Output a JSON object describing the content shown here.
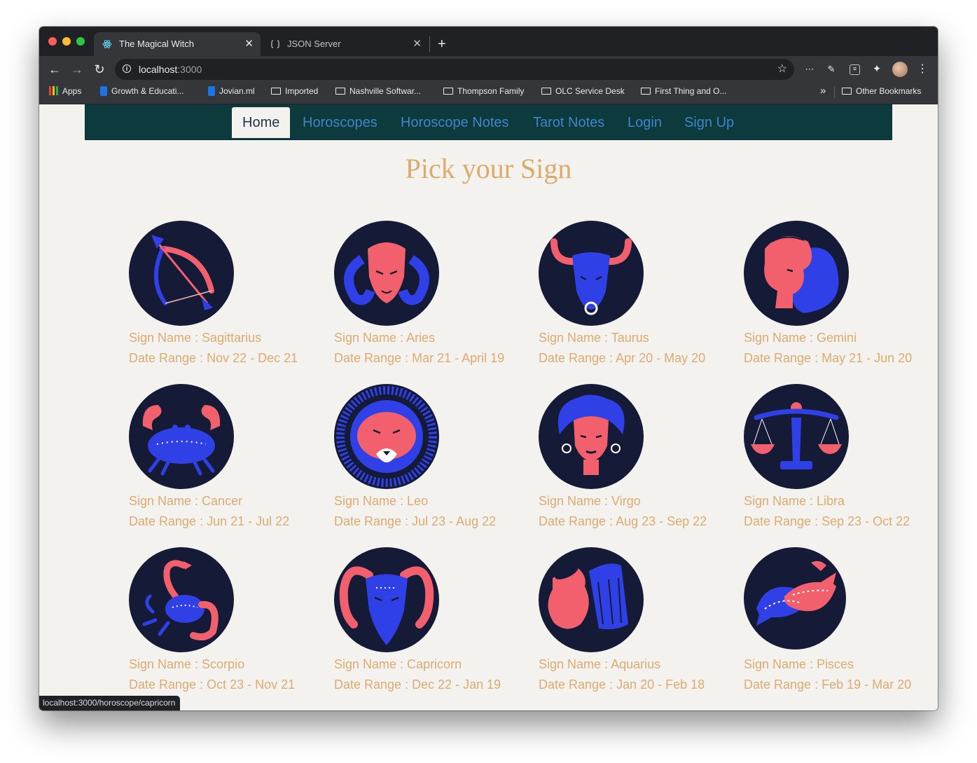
{
  "browser": {
    "tabs": [
      {
        "title": "The Magical Witch",
        "favicon": "react-icon",
        "active": true
      },
      {
        "title": "JSON Server",
        "favicon": "json-server-icon",
        "active": false
      }
    ],
    "close_glyph": "✕",
    "new_tab_glyph": "+",
    "url_host": "localhost",
    "url_port": ":3000",
    "bookmarks": [
      {
        "label": "Apps",
        "icon": "apps-grid-icon"
      },
      {
        "label": "Growth & Educati...",
        "icon": "bookmark-site-icon"
      },
      {
        "label": "Jovian.ml",
        "icon": "bookmark-site-icon"
      },
      {
        "label": "Imported",
        "icon": "folder-icon"
      },
      {
        "label": "Nashville Softwar...",
        "icon": "folder-icon"
      },
      {
        "label": "Thompson Family",
        "icon": "folder-icon"
      },
      {
        "label": "OLC Service Desk",
        "icon": "folder-icon"
      },
      {
        "label": "First Thing and O...",
        "icon": "folder-icon"
      },
      {
        "label": "Other Bookmarks",
        "icon": "folder-icon"
      }
    ],
    "overflow_glyph": "»",
    "status_url": "localhost:3000/horoscope/capricorn"
  },
  "nav": {
    "items": [
      "Home",
      "Horoscopes",
      "Horoscope Notes",
      "Tarot Notes",
      "Login",
      "Sign Up"
    ],
    "active": "Home"
  },
  "page": {
    "title": "Pick your Sign",
    "name_prefix": "Sign Name : ",
    "range_prefix": "Date Range : "
  },
  "signs": [
    {
      "name": "Sagittarius",
      "range": "Nov 22 - Dec 21",
      "icon": "sagittarius-archer-icon"
    },
    {
      "name": "Aries",
      "range": "Mar 21 - April 19",
      "icon": "aries-ram-icon"
    },
    {
      "name": "Taurus",
      "range": "Apr 20 - May 20",
      "icon": "taurus-bull-icon"
    },
    {
      "name": "Gemini",
      "range": "May 21 - Jun 20",
      "icon": "gemini-twins-icon"
    },
    {
      "name": "Cancer",
      "range": "Jun 21 - Jul 22",
      "icon": "cancer-crab-icon"
    },
    {
      "name": "Leo",
      "range": "Jul 23 - Aug 22",
      "icon": "leo-lion-icon"
    },
    {
      "name": "Virgo",
      "range": "Aug 23 - Sep 22",
      "icon": "virgo-maiden-icon"
    },
    {
      "name": "Libra",
      "range": "Sep 23 - Oct 22",
      "icon": "libra-scales-icon"
    },
    {
      "name": "Scorpio",
      "range": "Oct 23 - Nov 21",
      "icon": "scorpio-scorpion-icon"
    },
    {
      "name": "Capricorn",
      "range": "Dec 22 - Jan 19",
      "icon": "capricorn-goat-icon"
    },
    {
      "name": "Aquarius",
      "range": "Jan 20 - Feb 18",
      "icon": "aquarius-water-bearer-icon"
    },
    {
      "name": "Pisces",
      "range": "Feb 19 - Mar 20",
      "icon": "pisces-fish-icon"
    }
  ],
  "colors": {
    "page_background": "#f4f2ef",
    "navbar_background": "#0c3a3d",
    "nav_link": "#3e86c9",
    "accent_gold": "#ddab70",
    "emblem_navy": "#151a36",
    "emblem_blue": "#2f40e6",
    "emblem_pink": "#f2606e"
  }
}
